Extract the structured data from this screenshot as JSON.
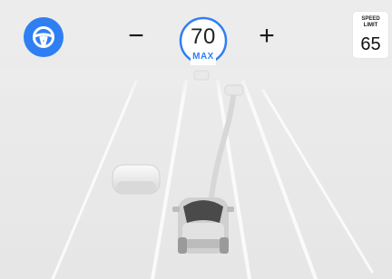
{
  "autopilot": {
    "icon": "steering-wheel-icon",
    "color": "#2f7ff2",
    "state": "engaged"
  },
  "cruise": {
    "decrease_label": "−",
    "increase_label": "+",
    "set_speed": "70",
    "mode_label": "MAX",
    "accent_color": "#2f7ff2"
  },
  "speed_limit": {
    "title_line1": "SPEED",
    "title_line2": "LIMIT",
    "value": "65"
  },
  "scene": {
    "path_color": "#2f7ff2",
    "objects": [
      "lead-vehicle",
      "lead-vehicle-adjacent-lane",
      "parked-vehicle-left",
      "ego-vehicle"
    ]
  }
}
